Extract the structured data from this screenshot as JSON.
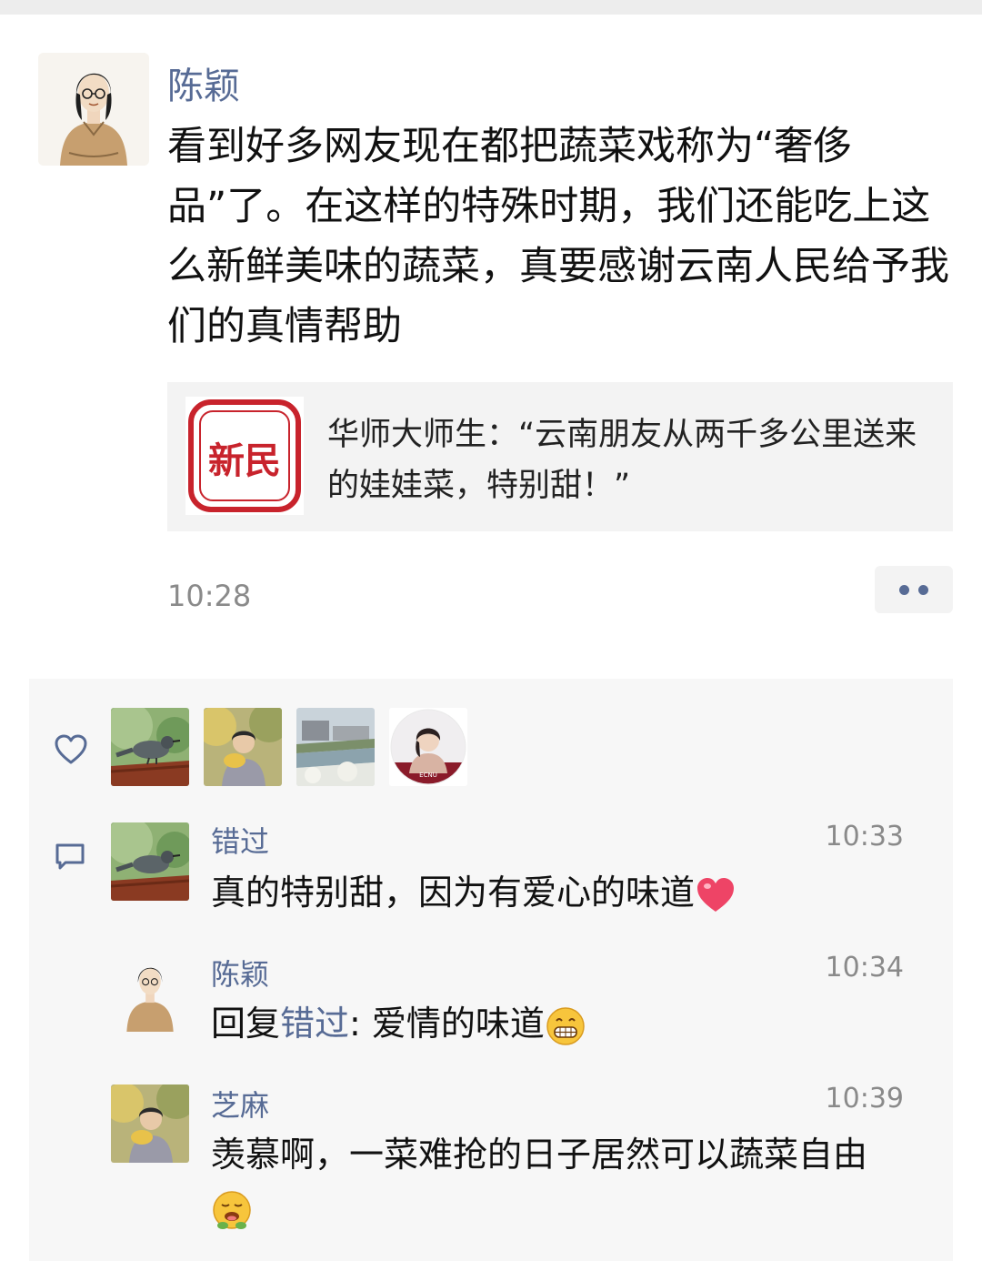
{
  "post": {
    "author": "陈颖",
    "text": "看到好多网友现在都把蔬菜戏称为“奢侈品”了。在这样的特殊时期，我们还能吃上这么新鲜美味的蔬菜，真要感谢云南人民给予我们的真情帮助",
    "time": "10:28"
  },
  "share": {
    "logo_text": "新民",
    "title": "华师大师生：“云南朋友从两千多公里送来的娃娃菜，特别甜！”",
    "logo_color": "#c8232c"
  },
  "likes": {
    "icon": "heart-outline-icon",
    "avatars": [
      "bird-avatar",
      "woman-fan-avatar",
      "river-campus-avatar",
      "ecnu-woman-avatar"
    ],
    "badge_text": "ECNU"
  },
  "comments": [
    {
      "name": "错过",
      "time": "10:33",
      "text": "真的特别甜，因为有爱心的味道",
      "emoji": "heart-emoji"
    },
    {
      "name": "陈颖",
      "time": "10:34",
      "reply_prefix": "回复",
      "reply_to": "错过",
      "text": ": 爱情的味道",
      "emoji": "grin-emoji"
    },
    {
      "name": "芝麻",
      "time": "10:39",
      "text": "羡慕啊，一菜难抢的日子居然可以蔬菜自由",
      "emoji": "drooling-emoji"
    }
  ],
  "colors": {
    "link_blue": "#576b95",
    "panel_bg": "#f7f7f7",
    "card_bg": "#f3f3f3"
  }
}
